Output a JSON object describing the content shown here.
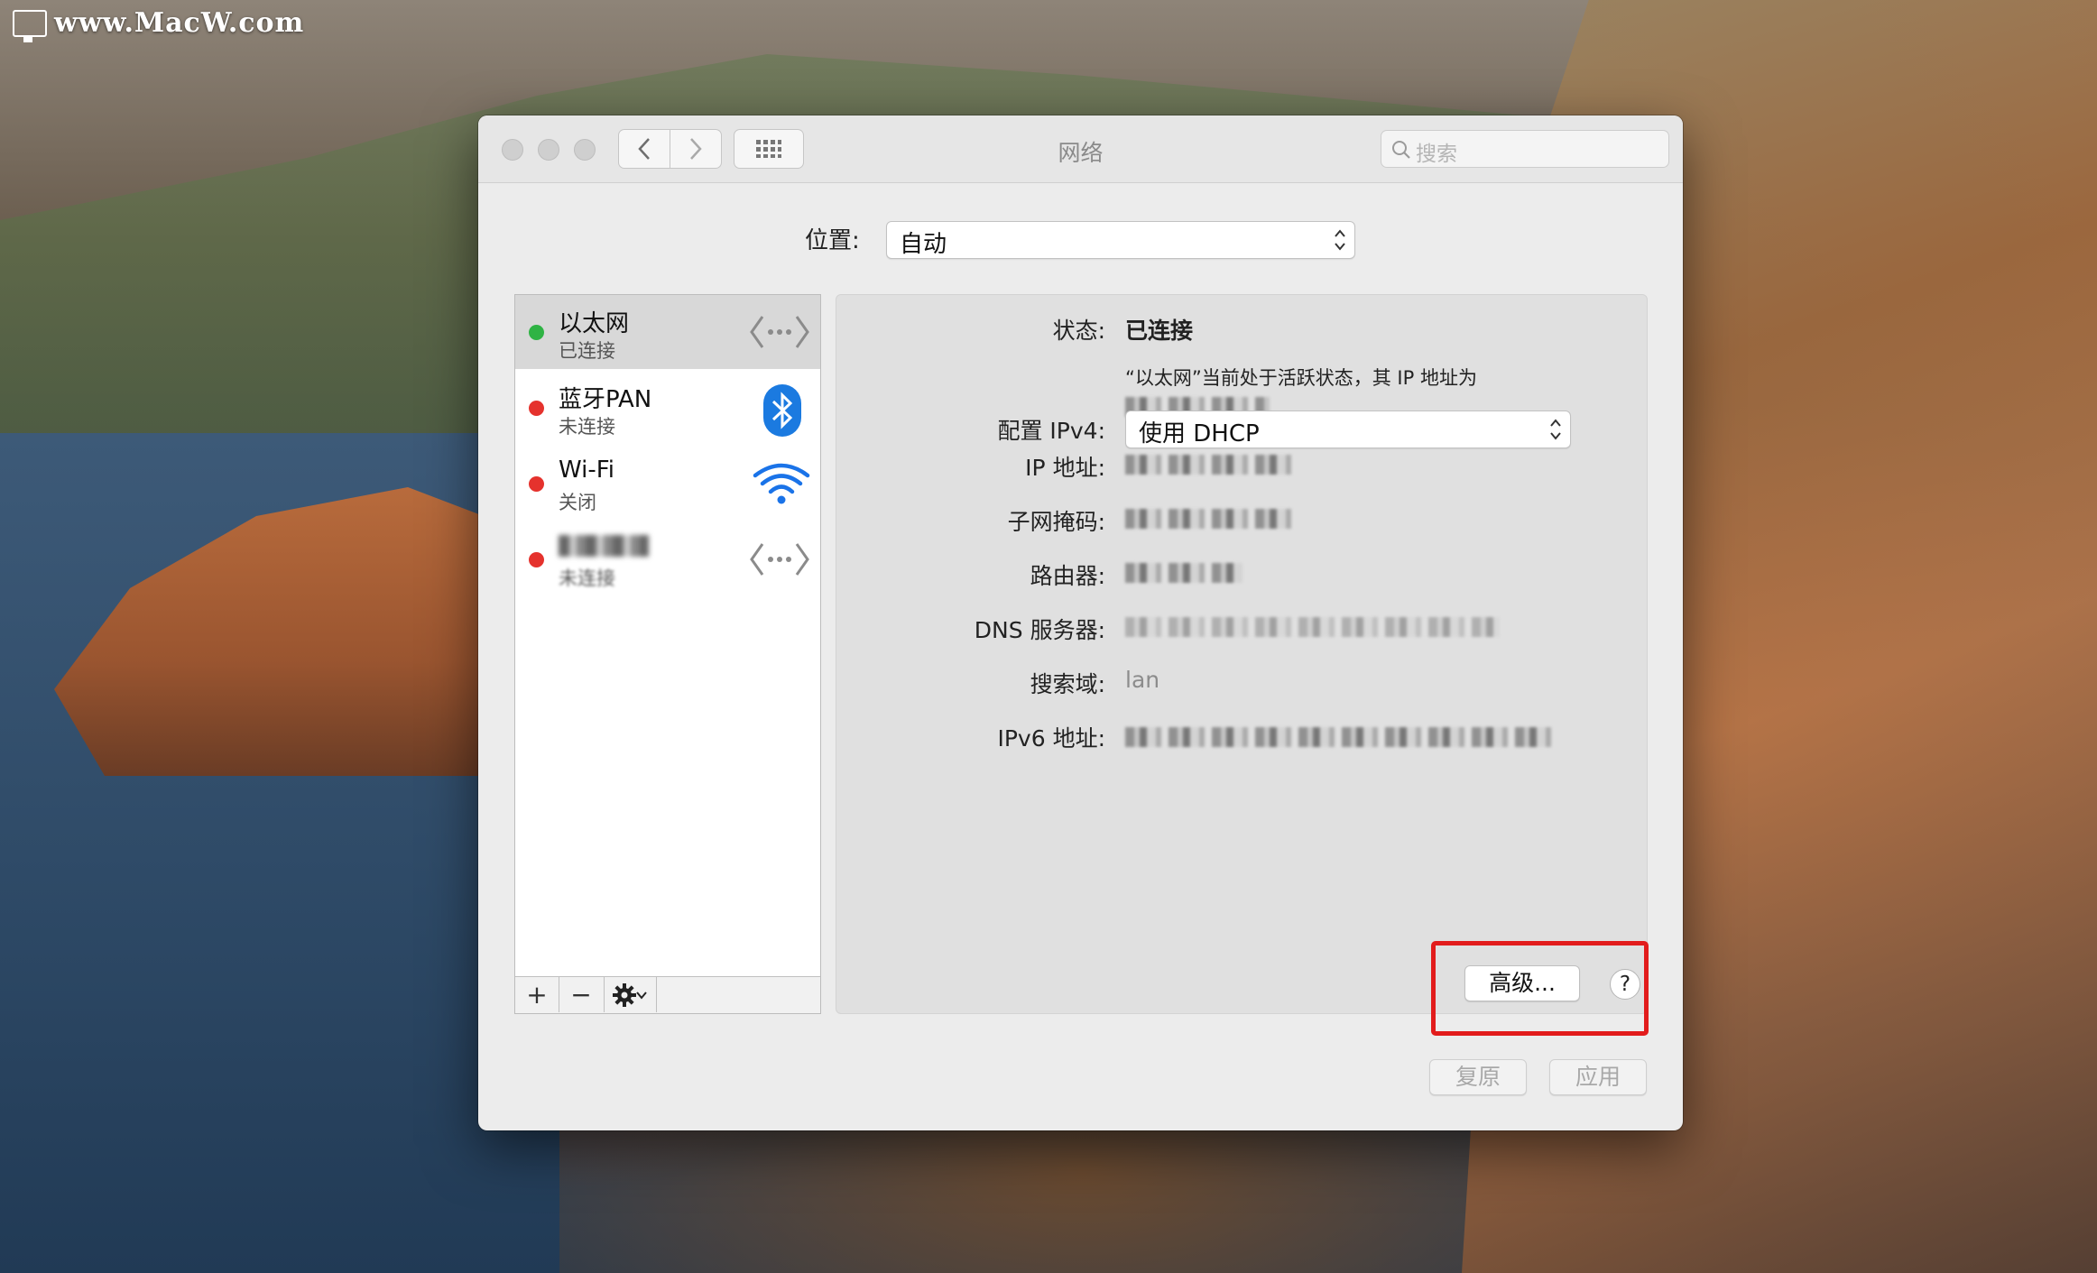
{
  "watermark": "www.MacW.com",
  "window": {
    "title": "网络",
    "search_placeholder": "搜索"
  },
  "location": {
    "label": "位置:",
    "value": "自动"
  },
  "services": [
    {
      "name": "以太网",
      "status": "已连接",
      "dot_color": "#2fb344",
      "icon": "ethernet-icon"
    },
    {
      "name": "蓝牙PAN",
      "status": "未连接",
      "dot_color": "#e5322d",
      "icon": "bluetooth-icon"
    },
    {
      "name": "Wi-Fi",
      "status": "关闭",
      "dot_color": "#e5322d",
      "icon": "wifi-icon"
    },
    {
      "name": "",
      "status": "未连接",
      "dot_color": "#e5322d",
      "icon": "ethernet-icon"
    }
  ],
  "sidebar_footer": {
    "add": "+",
    "remove": "−"
  },
  "detail": {
    "status_label": "状态:",
    "status_value": "已连接",
    "status_desc_prefix": "“以太网”当前处于活跃状态，其 IP 地址为",
    "configure_label": "配置 IPv4:",
    "configure_value": "使用 DHCP",
    "ip_label": "IP 地址:",
    "subnet_label": "子网掩码:",
    "router_label": "路由器:",
    "dns_label": "DNS 服务器:",
    "search_domain_label": "搜索域:",
    "search_domain_value": "lan",
    "ipv6_label": "IPv6 地址:"
  },
  "buttons": {
    "advanced": "高级...",
    "help": "?",
    "revert": "复原",
    "apply": "应用"
  },
  "colors": {
    "highlight": "#e21c1c",
    "accent_blue": "#1a73e8"
  }
}
